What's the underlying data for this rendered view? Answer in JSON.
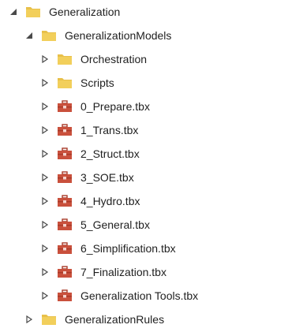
{
  "tree": {
    "root": {
      "label": "Generalization",
      "icon": "folder-icon",
      "state": "expanded"
    },
    "models": {
      "label": "GeneralizationModels",
      "icon": "folder-icon",
      "state": "expanded"
    },
    "children": [
      {
        "label": "Orchestration",
        "icon": "folder-icon",
        "state": "collapsed"
      },
      {
        "label": "Scripts",
        "icon": "folder-icon",
        "state": "collapsed"
      },
      {
        "label": "0_Prepare.tbx",
        "icon": "toolbox-icon",
        "state": "collapsed"
      },
      {
        "label": "1_Trans.tbx",
        "icon": "toolbox-icon",
        "state": "collapsed"
      },
      {
        "label": "2_Struct.tbx",
        "icon": "toolbox-icon",
        "state": "collapsed"
      },
      {
        "label": "3_SOE.tbx",
        "icon": "toolbox-icon",
        "state": "collapsed"
      },
      {
        "label": "4_Hydro.tbx",
        "icon": "toolbox-icon",
        "state": "collapsed"
      },
      {
        "label": "5_General.tbx",
        "icon": "toolbox-icon",
        "state": "collapsed"
      },
      {
        "label": "6_Simplification.tbx",
        "icon": "toolbox-icon",
        "state": "collapsed"
      },
      {
        "label": "7_Finalization.tbx",
        "icon": "toolbox-icon",
        "state": "collapsed"
      },
      {
        "label": "Generalization Tools.tbx",
        "icon": "toolbox-icon",
        "state": "collapsed"
      }
    ],
    "rules": {
      "label": "GeneralizationRules",
      "icon": "folder-icon",
      "state": "collapsed"
    }
  },
  "colors": {
    "folder": "#e8c04a",
    "folder_dark": "#d4a92c",
    "toolbox": "#c9503c",
    "toolbox_dark": "#a83a28",
    "arrow": "#4a4a4a"
  }
}
